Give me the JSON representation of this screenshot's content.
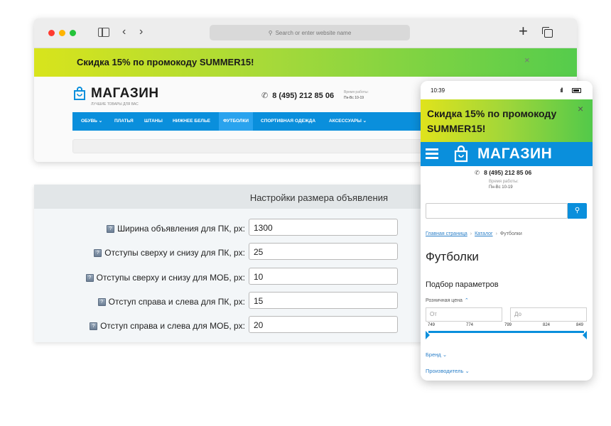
{
  "browser": {
    "address_placeholder": "Search or enter website name"
  },
  "promo": {
    "text": "Скидка 15% по промокоду SUMMER15!",
    "close": "×"
  },
  "site": {
    "logo_title": "МАГАЗИН",
    "logo_subtitle": "ЛУЧШИЕ ТОВАРЫ ДЛЯ ВАС",
    "phone": "8 (495) 212 85 06",
    "hours_label": "Время работы:",
    "hours_value": "Пн-Вс 10-19",
    "nav": [
      "ОБУВЬ ⌄",
      "ПЛАТЬЯ",
      "ШТАНЫ",
      "НИЖНЕЕ БЕЛЬЕ",
      "ФУТБОЛКИ",
      "СПОРТИВНАЯ ОДЕЖДА",
      "АКСЕССУАРЫ ⌄"
    ],
    "nav_active_index": 4
  },
  "settings": {
    "title": "Настройки размера объявления",
    "help_icon": "?",
    "rows": [
      {
        "label": "Ширина объявления для ПК, px:",
        "value": "1300"
      },
      {
        "label": "Отступы сверху и снизу для ПК, px:",
        "value": "25"
      },
      {
        "label": "Отступы сверху и снизу для МОБ, px:",
        "value": "10"
      },
      {
        "label": "Отступ справа и слева для ПК, px:",
        "value": "15"
      },
      {
        "label": "Отступ справа и слева для МОБ, px:",
        "value": "20"
      }
    ]
  },
  "mobile": {
    "time": "10:39",
    "signal": "ıll",
    "promo_text": "Скидка 15% по промокоду SUMMER15!",
    "promo_close": "×",
    "logo_title": "МАГАЗИН",
    "phone": "8 (495) 212 85 06",
    "hours_label": "Время работы:",
    "hours_value": "Пн-Вс 10-19",
    "search_icon": "⚲",
    "breadcrumbs": {
      "home": "Главная страница",
      "catalog": "Каталог",
      "current": "Футболки"
    },
    "page_title": "Футболки",
    "filter_title": "Подбор параметров",
    "price_label": "Розничная цена",
    "price_toggle": "⌃",
    "price_from_placeholder": "От",
    "price_to_placeholder": "До",
    "price_ticks": [
      "749",
      "774",
      "799",
      "824",
      "849"
    ],
    "brand_label": "Бренд",
    "brand_toggle": "⌄",
    "maker_label": "Производитель",
    "maker_toggle": "⌄"
  }
}
